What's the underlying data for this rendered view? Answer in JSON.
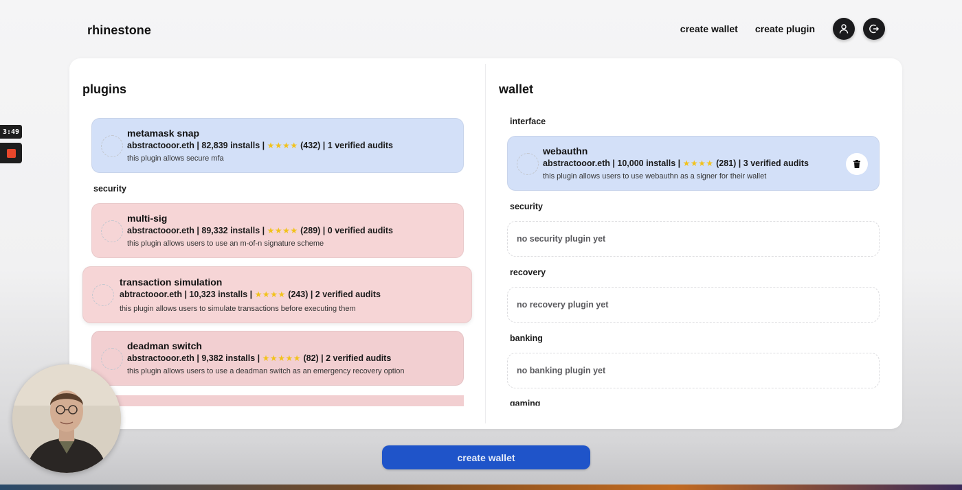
{
  "header": {
    "brand": "rhinestone",
    "nav": {
      "create_wallet": "create wallet",
      "create_plugin": "create plugin"
    },
    "icons": [
      "user-icon",
      "logout-icon"
    ]
  },
  "plugins_panel": {
    "title": "plugins",
    "top_item": {
      "name": "metamask snap",
      "meta": "abstractooor.eth | 82,839 installs |",
      "stars": "★★★★",
      "meta_tail": "(432) | 1 verified audits",
      "desc": "this plugin allows secure mfa"
    },
    "security_label": "security",
    "items": [
      {
        "name": "multi-sig",
        "meta": "abstractooor.eth | 89,332 installs |",
        "stars": "★★★★",
        "meta_tail": "(289) | 0 verified audits",
        "desc": "this plugin allows users to use an m-of-n signature scheme"
      },
      {
        "name": "transaction simulation",
        "meta": "abtractooor.eth | 10,323 installs |",
        "stars": "★★★★",
        "meta_tail": "(243) | 2 verified audits",
        "desc": "this plugin allows users to simulate transactions before executing them"
      },
      {
        "name": "deadman switch",
        "meta": "abstractooor.eth | 9,382 installs |",
        "stars": "★★★★★",
        "meta_tail": "(82) | 2 verified audits",
        "desc": "this plugin allows users to use a deadman switch as an emergency recovery option"
      }
    ]
  },
  "wallet_panel": {
    "title": "wallet",
    "interface_label": "interface",
    "interface_item": {
      "name": "webauthn",
      "meta": "abstractooor.eth | 10,000 installs |",
      "stars": "★★★★",
      "meta_tail": "(281) | 3 verified audits",
      "desc": "this plugin allows users to use webauthn as a signer for their wallet"
    },
    "security_label": "security",
    "security_empty": "no security plugin yet",
    "recovery_label": "recovery",
    "recovery_empty": "no recovery plugin yet",
    "banking_label": "banking",
    "banking_empty": "no banking plugin yet",
    "gaming_label": "gaming"
  },
  "footer": {
    "create_wallet_button": "create wallet"
  },
  "recording": {
    "time": "3:49"
  },
  "colors": {
    "installed_blue": "#d3e0f8",
    "security_pink": "#f6d5d6",
    "primary_button": "#1f54c9",
    "stars": "#f2c21b"
  }
}
